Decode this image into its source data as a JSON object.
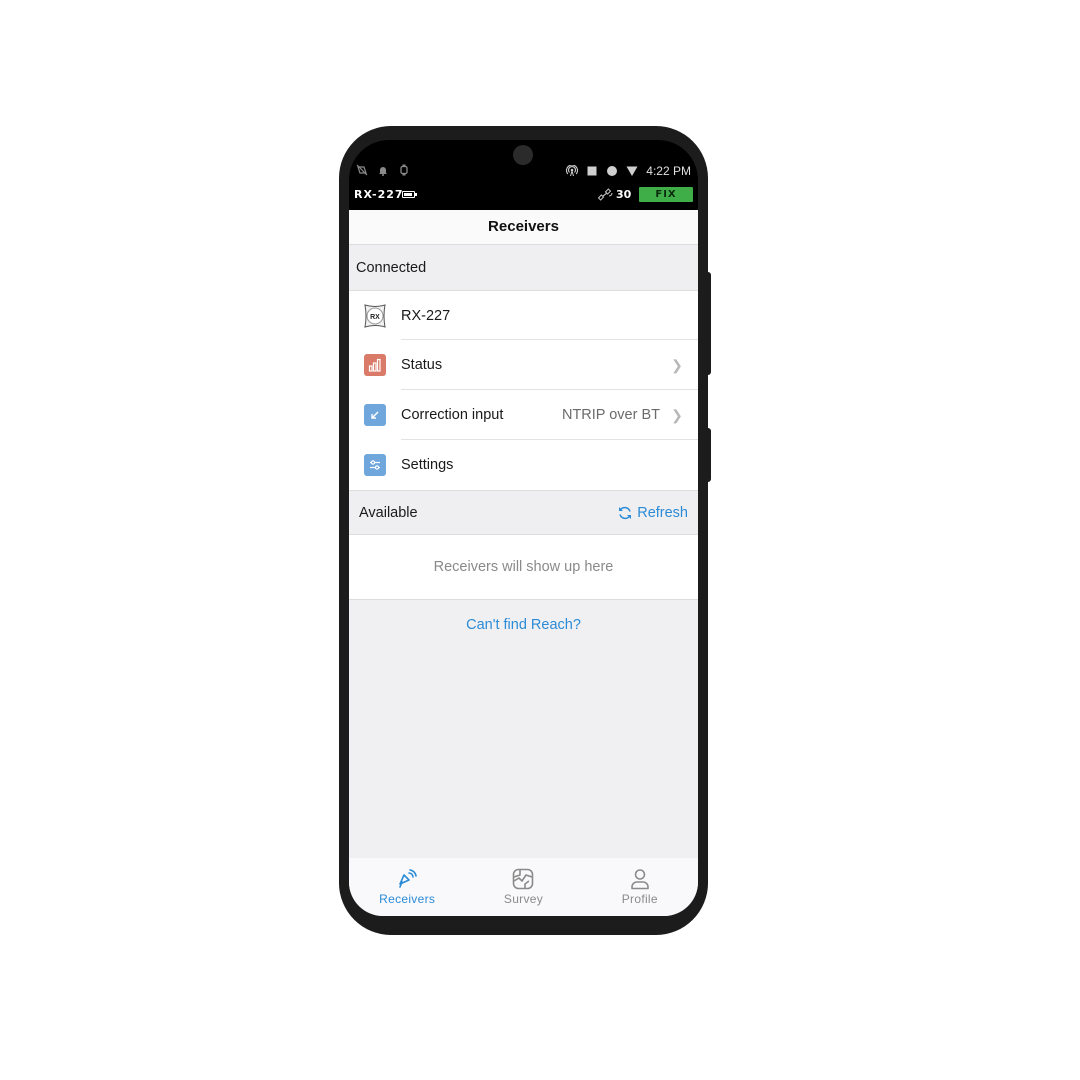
{
  "status_bar": {
    "time": "4:22 PM",
    "left_icons": [
      "silent-mode-icon",
      "notification-bell-icon",
      "smartwatch-icon"
    ],
    "right_icons": [
      "hotspot-icon",
      "stop-square-icon",
      "record-dot-icon",
      "wifi-signal-icon"
    ]
  },
  "receiver_bar": {
    "name": "RX-227",
    "satellite_count": "30",
    "fix_status": "FIX",
    "fix_color": "#3fae49"
  },
  "navbar": {
    "title": "Receivers"
  },
  "connected": {
    "header": "Connected",
    "device": {
      "icon_label": "RX",
      "name": "RX-227"
    },
    "items": [
      {
        "label": "Status",
        "value": "",
        "icon": "bar-chart-icon",
        "color": "#d97b68",
        "chevron": true
      },
      {
        "label": "Correction input",
        "value": "NTRIP over BT",
        "icon": "arrow-down-left-icon",
        "color": "#6fa6dc",
        "chevron": true
      },
      {
        "label": "Settings",
        "value": "",
        "icon": "sliders-icon",
        "color": "#6fa6dc",
        "chevron": false
      }
    ]
  },
  "available": {
    "header": "Available",
    "refresh_label": "Refresh",
    "empty_text": "Receivers will show up here",
    "help_link": "Can't find Reach?"
  },
  "tabs": [
    {
      "label": "Receivers",
      "icon": "satellite-signal-icon",
      "active": true
    },
    {
      "label": "Survey",
      "icon": "map-icon",
      "active": false
    },
    {
      "label": "Profile",
      "icon": "user-icon",
      "active": false
    }
  ],
  "colors": {
    "accent": "#2b8bd6"
  }
}
